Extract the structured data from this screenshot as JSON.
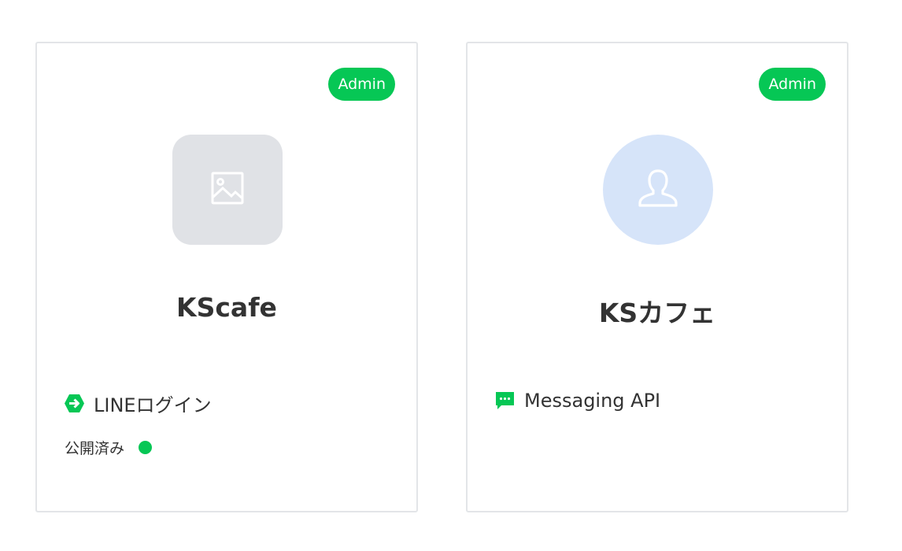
{
  "colors": {
    "accent_green": "#06c755",
    "placeholder_gray": "#e0e2e6",
    "avatar_blue": "#d6e4f9",
    "text": "#333333",
    "border": "#e3e5e8"
  },
  "channels": [
    {
      "badge": "Admin",
      "avatar_icon": "image-placeholder-icon",
      "name": "KScafe",
      "channel_icon": "line-login-icon",
      "channel_type": "LINEログイン",
      "status": "公開済み"
    },
    {
      "badge": "Admin",
      "avatar_icon": "user-placeholder-icon",
      "name": "KSカフェ",
      "channel_icon": "messaging-api-icon",
      "channel_type": "Messaging API"
    }
  ]
}
